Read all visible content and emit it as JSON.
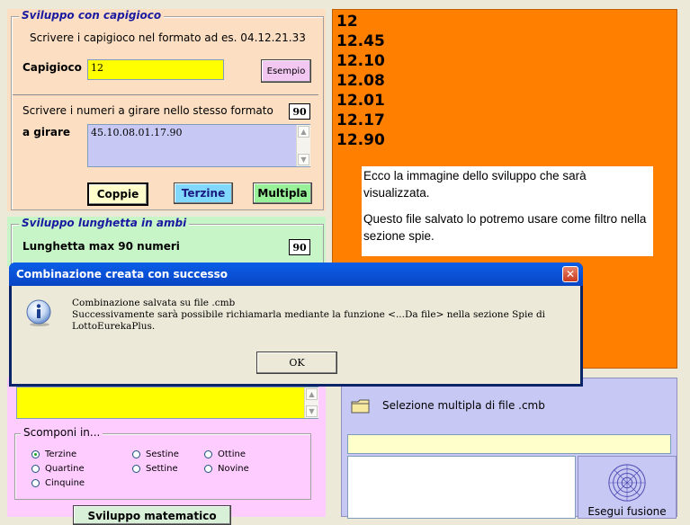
{
  "capigioco_panel": {
    "title": "Sviluppo con capigioco",
    "instruction": "Scrivere i capigioco nel formato ad es. 04.12.21.33",
    "label": "Capigioco",
    "value": "12",
    "example_button": "Esempio",
    "girare_instruction": "Scrivere i numeri a girare nello stesso formato",
    "girare_count": "90",
    "girare_label": "a girare",
    "girare_value": "45.10.08.01.17.90",
    "buttons": {
      "coppie": "Coppie",
      "terzine": "Terzine",
      "multipla": "Multipla"
    }
  },
  "lunghetta_panel": {
    "title": "Sviluppo lunghetta in ambi",
    "label": "Lunghetta max 90 numeri",
    "count": "90"
  },
  "scomponi_panel": {
    "legend": "Scomponi in...",
    "options": [
      {
        "label": "Terzine",
        "checked": true
      },
      {
        "label": "Quartine",
        "checked": false
      },
      {
        "label": "Cinquine",
        "checked": false
      },
      {
        "label": "Sestine",
        "checked": false
      },
      {
        "label": "Settine",
        "checked": false
      },
      {
        "label": "Ottine",
        "checked": false
      },
      {
        "label": "Novine",
        "checked": false
      }
    ],
    "bottom_button": "Sviluppo matematico"
  },
  "output_panel": {
    "lines": [
      "12",
      "12.45",
      "12.10",
      "12.08",
      "12.01",
      "12.17",
      "12.90"
    ],
    "info_line1": "Ecco la immagine dello sviluppo che sarà visualizzata.",
    "info_line2": "Questo file salvato lo potremo usare come filtro nella sezione spie.",
    "color": "#FF7F00"
  },
  "fusion_panel": {
    "label": "Selezione multipla di file .cmb",
    "run_button": "Esegui fusione"
  },
  "dialog": {
    "title": "Combinazione creata con successo",
    "message_line1": "Combinazione salvata su file .cmb",
    "message_line2": "Successivamente sarà possibile richiamarla mediante la funzione <...Da file> nella sezione Spie di",
    "message_line3": "LottoEurekaPlus.",
    "ok_label": "OK",
    "close_glyph": "✕"
  }
}
